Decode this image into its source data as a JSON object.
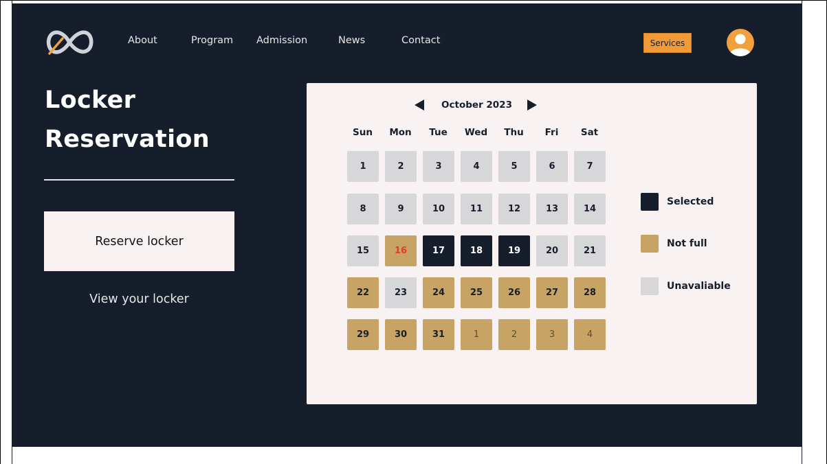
{
  "nav": {
    "items": [
      "About",
      "Program",
      "Admission",
      "News",
      "Contact"
    ],
    "services_label": "Services"
  },
  "page": {
    "title": "Locker Reservation",
    "reserve_label": "Reserve locker",
    "view_label": "View your locker"
  },
  "calendar": {
    "month_label": "October 2023",
    "weekdays": [
      "Sun",
      "Mon",
      "Tue",
      "Wed",
      "Thu",
      "Fri",
      "Sat"
    ],
    "weeks": [
      [
        {
          "d": "1",
          "s": "unavailable"
        },
        {
          "d": "2",
          "s": "unavailable"
        },
        {
          "d": "3",
          "s": "unavailable"
        },
        {
          "d": "4",
          "s": "unavailable"
        },
        {
          "d": "5",
          "s": "unavailable"
        },
        {
          "d": "6",
          "s": "unavailable"
        },
        {
          "d": "7",
          "s": "unavailable"
        }
      ],
      [
        {
          "d": "8",
          "s": "unavailable"
        },
        {
          "d": "9",
          "s": "unavailable"
        },
        {
          "d": "10",
          "s": "unavailable"
        },
        {
          "d": "11",
          "s": "unavailable"
        },
        {
          "d": "12",
          "s": "unavailable"
        },
        {
          "d": "13",
          "s": "unavailable"
        },
        {
          "d": "14",
          "s": "unavailable"
        }
      ],
      [
        {
          "d": "15",
          "s": "unavailable"
        },
        {
          "d": "16",
          "s": "notfull",
          "today": true
        },
        {
          "d": "17",
          "s": "selected"
        },
        {
          "d": "18",
          "s": "selected"
        },
        {
          "d": "19",
          "s": "selected"
        },
        {
          "d": "20",
          "s": "unavailable"
        },
        {
          "d": "21",
          "s": "unavailable"
        }
      ],
      [
        {
          "d": "22",
          "s": "notfull"
        },
        {
          "d": "23",
          "s": "unavailable"
        },
        {
          "d": "24",
          "s": "notfull"
        },
        {
          "d": "25",
          "s": "notfull"
        },
        {
          "d": "26",
          "s": "notfull"
        },
        {
          "d": "27",
          "s": "notfull"
        },
        {
          "d": "28",
          "s": "notfull"
        }
      ],
      [
        {
          "d": "29",
          "s": "notfull"
        },
        {
          "d": "30",
          "s": "notfull"
        },
        {
          "d": "31",
          "s": "notfull"
        },
        {
          "d": "1",
          "s": "notfull",
          "outside": true
        },
        {
          "d": "2",
          "s": "notfull",
          "outside": true
        },
        {
          "d": "3",
          "s": "notfull",
          "outside": true
        },
        {
          "d": "4",
          "s": "notfull",
          "outside": true
        }
      ]
    ]
  },
  "legend": {
    "selected": "Selected",
    "not_full": "Not full",
    "unavailable": "Unavaliable"
  },
  "colors": {
    "background": "#161e2c",
    "panel": "#f8f3f2",
    "selected": "#161e2c",
    "not_full": "#c8a464",
    "unavailable": "#d7d7d9",
    "accent": "#f19b36",
    "today_text": "#e23b2a"
  },
  "icons": {
    "logo": "infinity-logo-icon",
    "avatar": "user-avatar-icon",
    "prev": "arrow-left-icon",
    "next": "arrow-right-icon"
  }
}
